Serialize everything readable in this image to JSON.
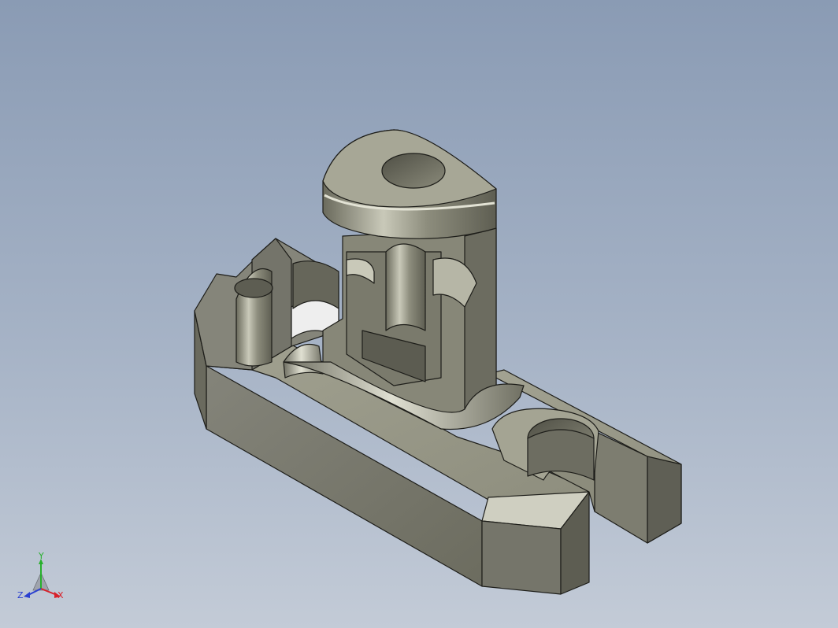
{
  "viewport": {
    "background_top": "#8a9bb4",
    "background_bottom": "#c3cbd7"
  },
  "model": {
    "render_style": "shaded-with-edges",
    "colors": {
      "body_side": "#7b7b6c",
      "body_top": "#9a9a89",
      "body_dark": "#5f5f55",
      "highlight": "#d6d6c8",
      "edge": "#1d1d19"
    }
  },
  "triad": {
    "x_label": "X",
    "y_label": "Y",
    "z_label": "Z",
    "x_color": "#d8202a",
    "y_color": "#27b02c",
    "z_color": "#2a3fd0"
  }
}
